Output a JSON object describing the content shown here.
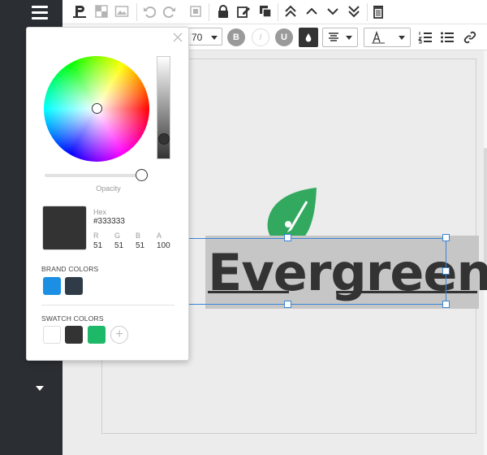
{
  "toolbar": {
    "font_size_value": "70",
    "bold_label": "B",
    "italic_label": "I",
    "underline_label": "U",
    "text_color": "#333333"
  },
  "logo": {
    "text": "Evergreen",
    "text_color": "#333333",
    "leaf_color": "#33a960"
  },
  "color_picker": {
    "opacity_label": "Opacity",
    "current_color": "#333333",
    "opacity_percent": 100,
    "hex_label": "Hex",
    "hex_value": "#333333",
    "rgba_labels": [
      "R",
      "G",
      "B",
      "A"
    ],
    "rgba_values": [
      "51",
      "51",
      "51",
      "100"
    ],
    "brand_colors_title": "BRAND COLORS",
    "brand_colors": [
      "#1a8fe3",
      "#2f3c48"
    ],
    "swatch_colors_title": "SWATCH COLORS",
    "swatch_colors": [
      "#ffffff",
      "#333333",
      "#1db868"
    ],
    "add_swatch_label": "+"
  }
}
